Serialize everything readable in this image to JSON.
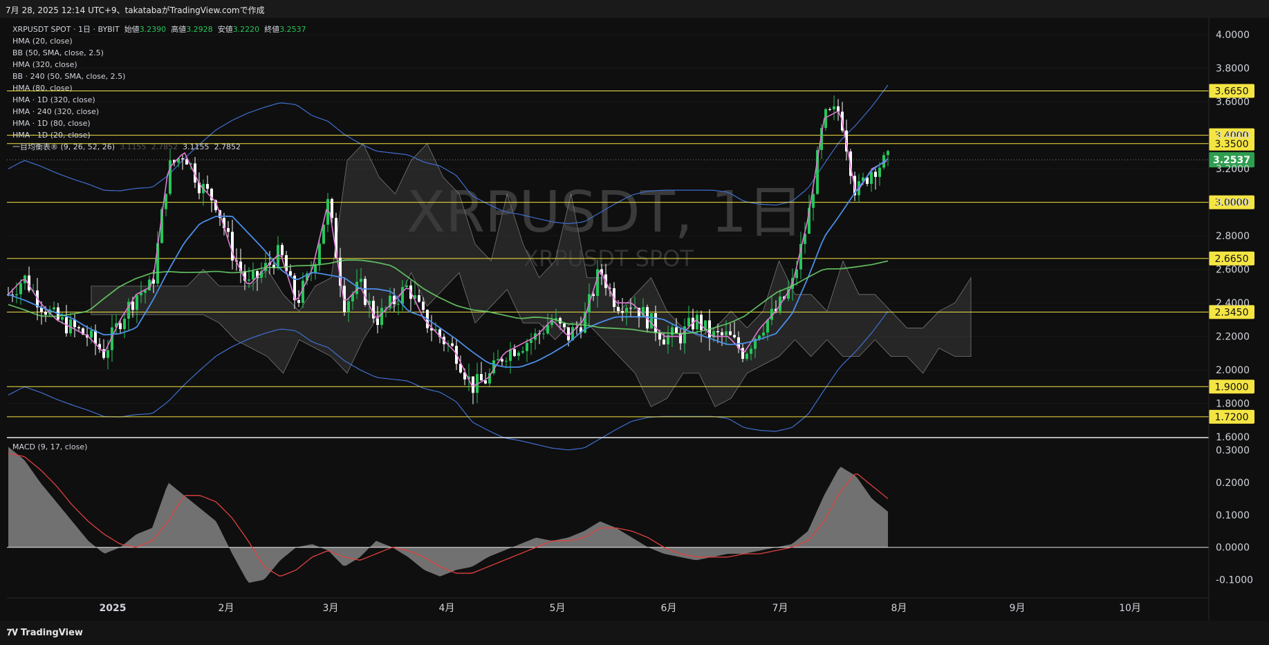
{
  "header": {
    "caption": "7月 28, 2025 12:14 UTC+9、takatabaがTradingView.comで作成"
  },
  "watermark": {
    "main": "XRPUSDT, 1日",
    "sub": "XRPUSDT SPOT"
  },
  "legend": {
    "symbol": "XRPUSDT SPOT · 1日 · BYBIT",
    "open_label": "始値",
    "open": "3.2390",
    "high_label": "高値",
    "high": "3.2928",
    "low_label": "安値",
    "low": "3.2220",
    "close_label": "終値",
    "close": "3.2537",
    "indicators": [
      "HMA (20, close)",
      "BB (50, SMA, close, 2.5)",
      "HMA (320, close)",
      "BB · 240 (50, SMA, close, 2.5)",
      "HMA (80, close)",
      "HMA · 1D (320, close)",
      "HMA · 240 (320, close)",
      "HMA · 1D (80, close)",
      "HMA · 1D (20, close)"
    ],
    "ichimoku": "一目均衡表® (9, 26, 52, 26)",
    "ichimoku_values": [
      "3.1155",
      "2.7852",
      "3.1155",
      "2.7852"
    ]
  },
  "macd_title": "MACD (9, 17, close)",
  "branding": {
    "logo": "TradingView"
  },
  "colors": {
    "up": "#26c65a",
    "down": "#ffffff",
    "hma20": "#e07ad6",
    "hma80": "#4a8fe8",
    "hma320": "#6bd36b",
    "bb": "#3f6fd0",
    "level": "#f5e542",
    "macd_signal": "#e0413f",
    "last_price": "#2e9e4f"
  },
  "chart_data": {
    "type": "candlestick",
    "timeframe": "1D",
    "x_labels": [
      "2025",
      "2月",
      "3月",
      "4月",
      "5月",
      "6月",
      "7月",
      "8月",
      "9月",
      "10月"
    ],
    "y_ticks": [
      "4.0000",
      "3.8000",
      "3.6000",
      "3.4000",
      "3.2000",
      "3.0000",
      "2.8000",
      "2.6000",
      "2.4000",
      "2.2000",
      "2.0000",
      "1.8000",
      "1.6000"
    ],
    "horizontal_levels": [
      "3.6650",
      "3.4000",
      "3.3500",
      "3.0000",
      "2.6650",
      "2.3450",
      "1.9000",
      "1.7200"
    ],
    "last_price": "3.2537",
    "price_ylim": [
      1.6,
      4.1
    ],
    "price_path": [
      2.45,
      2.55,
      2.4,
      2.3,
      2.25,
      2.2,
      2.1,
      2.3,
      2.45,
      2.5,
      3.2,
      3.3,
      3.1,
      3.0,
      2.7,
      2.5,
      2.6,
      2.7,
      2.4,
      2.6,
      3.0,
      2.4,
      2.5,
      2.3,
      2.4,
      2.5,
      2.3,
      2.2,
      2.1,
      1.9,
      1.95,
      2.1,
      2.15,
      2.2,
      2.3,
      2.2,
      2.3,
      2.6,
      2.4,
      2.4,
      2.3,
      2.2,
      2.2,
      2.3,
      2.2,
      2.2,
      2.1,
      2.25,
      2.35,
      2.5,
      2.9,
      3.5,
      3.55,
      3.05,
      3.2,
      3.25
    ],
    "macd_ylim": [
      -0.15,
      0.33
    ],
    "macd_ticks": [
      "0.3000",
      "0.2000",
      "0.1000",
      "0.0000",
      "-0.1000"
    ],
    "macd_values": [
      0.31,
      0.27,
      0.2,
      0.14,
      0.08,
      0.02,
      -0.02,
      0.0,
      0.04,
      0.06,
      0.2,
      0.16,
      0.12,
      0.08,
      -0.02,
      -0.11,
      -0.1,
      -0.04,
      0.0,
      0.01,
      -0.01,
      -0.06,
      -0.03,
      0.02,
      0.0,
      -0.03,
      -0.07,
      -0.09,
      -0.07,
      -0.06,
      -0.03,
      -0.01,
      0.01,
      0.03,
      0.02,
      0.03,
      0.05,
      0.08,
      0.06,
      0.03,
      0.0,
      -0.02,
      -0.03,
      -0.04,
      -0.03,
      -0.02,
      -0.02,
      -0.01,
      0.0,
      0.01,
      0.05,
      0.16,
      0.25,
      0.22,
      0.15,
      0.11
    ],
    "macd_signal": [
      0.29,
      0.28,
      0.24,
      0.19,
      0.13,
      0.08,
      0.04,
      0.01,
      0.0,
      0.02,
      0.08,
      0.16,
      0.16,
      0.14,
      0.09,
      0.02,
      -0.06,
      -0.09,
      -0.07,
      -0.03,
      -0.01,
      -0.03,
      -0.04,
      -0.02,
      0.0,
      -0.01,
      -0.03,
      -0.06,
      -0.08,
      -0.08,
      -0.06,
      -0.04,
      -0.02,
      0.0,
      0.02,
      0.02,
      0.03,
      0.06,
      0.06,
      0.05,
      0.03,
      0.0,
      -0.02,
      -0.03,
      -0.03,
      -0.03,
      -0.02,
      -0.02,
      -0.01,
      0.0,
      0.02,
      0.08,
      0.17,
      0.23,
      0.19,
      0.15
    ]
  }
}
